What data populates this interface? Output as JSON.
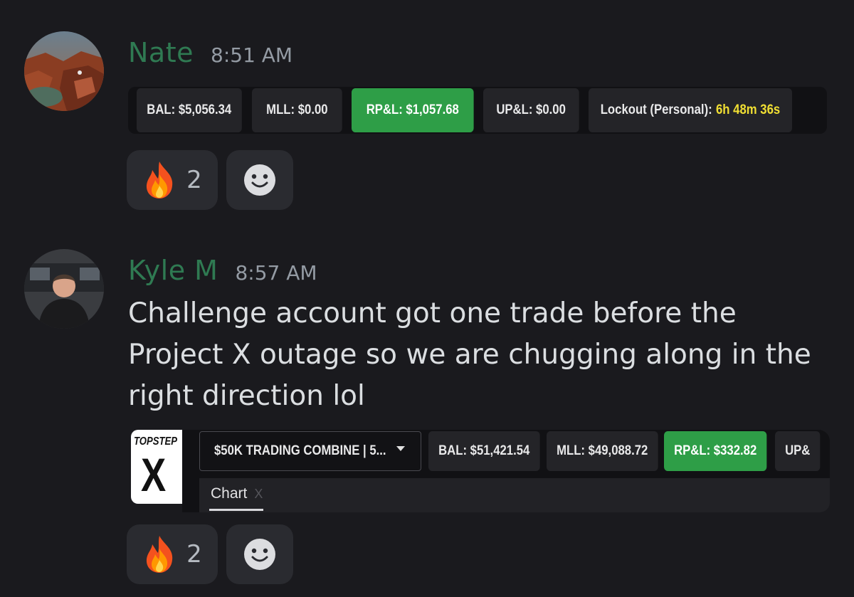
{
  "messages": [
    {
      "username": "Nate",
      "time": "8:51 AM",
      "stats": [
        {
          "label": "BAL: $5,056.34",
          "highlight": false
        },
        {
          "label": "MLL: $0.00",
          "highlight": false
        },
        {
          "label": "RP&L: $1,057.68",
          "highlight": true
        },
        {
          "label": "UP&L: $0.00",
          "highlight": false
        }
      ],
      "lockout_label": "Lockout (Personal):",
      "lockout_value": "6h 48m 36s",
      "reactions": [
        {
          "emoji": "fire-emoji",
          "count": "2"
        },
        {
          "emoji": "add-reaction-icon"
        }
      ]
    },
    {
      "username": "Kyle M",
      "time": "8:57 AM",
      "text": "Challenge account got one trade before the Project X outage so we are chugging along in the right direction lol",
      "logo_top": "TOPSTEP",
      "logo_mark": "X",
      "account_select": "$50K TRADING COMBINE | 5...",
      "stats": [
        {
          "label": "BAL: $51,421.54",
          "highlight": false
        },
        {
          "label": "MLL: $49,088.72",
          "highlight": false
        },
        {
          "label": "RP&L: $332.82",
          "highlight": true
        },
        {
          "label": "UP&",
          "highlight": false
        }
      ],
      "tab_label": "Chart",
      "tab_close": "X",
      "reactions": [
        {
          "emoji": "fire-emoji",
          "count": "2"
        },
        {
          "emoji": "add-reaction-icon"
        }
      ]
    }
  ],
  "colors": {
    "background": "#1a1a1e",
    "username": "#2f7a52",
    "green_pill": "#2e9e47",
    "lockout_timer": "#f1df33"
  }
}
